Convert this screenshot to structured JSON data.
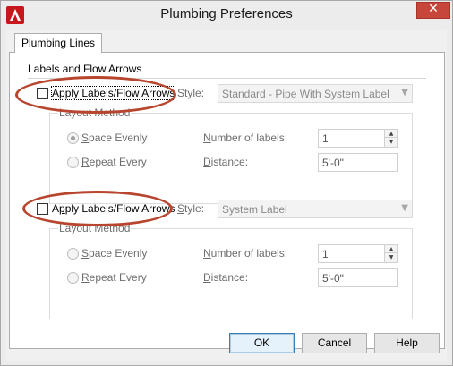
{
  "window": {
    "title": "Plumbing Preferences",
    "close_glyph": "✕"
  },
  "tabs": [
    {
      "label": "Plumbing Lines",
      "active": true
    }
  ],
  "group": {
    "title": "Labels and Flow Arrows"
  },
  "section1": {
    "checkbox_label_prefix": "A",
    "checkbox_label_underlined": "p",
    "checkbox_label_rest": "ply Labels/Flow Arrows",
    "checked": false,
    "style_label_u": "S",
    "style_label_rest": "tyle:",
    "style_value": "Standard - Pipe With System Label",
    "layout_title": "Layout Method",
    "space_evenly_u": "S",
    "space_evenly_rest": "pace Evenly",
    "space_evenly_selected": true,
    "repeat_every_u": "R",
    "repeat_every_rest": "epeat Every",
    "num_labels_u": "N",
    "num_labels_rest": "umber of labels:",
    "num_labels_value": "1",
    "distance_u": "D",
    "distance_rest": "istance:",
    "distance_value": "5'-0\""
  },
  "section2": {
    "checkbox_label_prefix": "A",
    "checkbox_label_underlined": "p",
    "checkbox_label_rest": "ply Labels/Flow Arrows",
    "checked": false,
    "style_label_u": "S",
    "style_label_rest": "tyle:",
    "style_value": "System Label",
    "layout_title": "Layout Method",
    "space_evenly_u": "S",
    "space_evenly_rest": "pace Evenly",
    "space_evenly_selected": false,
    "repeat_every_u": "R",
    "repeat_every_rest": "epeat Every",
    "num_labels_u": "N",
    "num_labels_rest": "umber of labels:",
    "num_labels_value": "1",
    "distance_u": "D",
    "distance_rest": "istance:",
    "distance_value": "5'-0\""
  },
  "buttons": {
    "ok": "OK",
    "cancel": "Cancel",
    "help": "Help"
  },
  "colors": {
    "annotation_ellipse": "#b8452e",
    "close_button": "#c7463c",
    "app_icon": "#c8161d"
  }
}
